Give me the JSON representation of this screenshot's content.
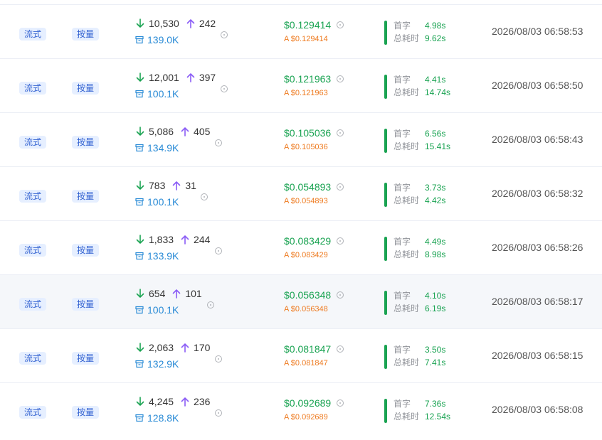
{
  "labels": {
    "first_token": "首字",
    "total_time": "总耗时"
  },
  "colors": {
    "tag_text": "#2f5fd0",
    "tag_bg": "#e6efff",
    "input_arrow": "#1aa352",
    "output_arrow": "#8a5cf6",
    "cache": "#2a8bd6",
    "price": "#1aa352",
    "actual_price": "#ee7a1f",
    "timing_value": "#1aa352"
  },
  "rows": [
    {
      "mode": "流式",
      "billing": "按量",
      "input": "10,530",
      "output": "242",
      "cache": "139.0K",
      "price": "$0.129414",
      "actual": "A $0.129414",
      "first": "4.98s",
      "total": "9.62s",
      "time": "2026/08/03 06:58:53"
    },
    {
      "mode": "流式",
      "billing": "按量",
      "input": "12,001",
      "output": "397",
      "cache": "100.1K",
      "price": "$0.121963",
      "actual": "A $0.121963",
      "first": "4.41s",
      "total": "14.74s",
      "time": "2026/08/03 06:58:50"
    },
    {
      "mode": "流式",
      "billing": "按量",
      "input": "5,086",
      "output": "405",
      "cache": "134.9K",
      "price": "$0.105036",
      "actual": "A $0.105036",
      "first": "6.56s",
      "total": "15.41s",
      "time": "2026/08/03 06:58:43"
    },
    {
      "mode": "流式",
      "billing": "按量",
      "input": "783",
      "output": "31",
      "cache": "100.1K",
      "price": "$0.054893",
      "actual": "A $0.054893",
      "first": "3.73s",
      "total": "4.42s",
      "time": "2026/08/03 06:58:32"
    },
    {
      "mode": "流式",
      "billing": "按量",
      "input": "1,833",
      "output": "244",
      "cache": "133.9K",
      "price": "$0.083429",
      "actual": "A $0.083429",
      "first": "4.49s",
      "total": "8.98s",
      "time": "2026/08/03 06:58:26"
    },
    {
      "mode": "流式",
      "billing": "按量",
      "input": "654",
      "output": "101",
      "cache": "100.1K",
      "price": "$0.056348",
      "actual": "A $0.056348",
      "first": "4.10s",
      "total": "6.19s",
      "time": "2026/08/03 06:58:17"
    },
    {
      "mode": "流式",
      "billing": "按量",
      "input": "2,063",
      "output": "170",
      "cache": "132.9K",
      "price": "$0.081847",
      "actual": "A $0.081847",
      "first": "3.50s",
      "total": "7.41s",
      "time": "2026/08/03 06:58:15"
    },
    {
      "mode": "流式",
      "billing": "按量",
      "input": "4,245",
      "output": "236",
      "cache": "128.8K",
      "price": "$0.092689",
      "actual": "A $0.092689",
      "first": "7.36s",
      "total": "12.54s",
      "time": "2026/08/03 06:58:08"
    }
  ]
}
